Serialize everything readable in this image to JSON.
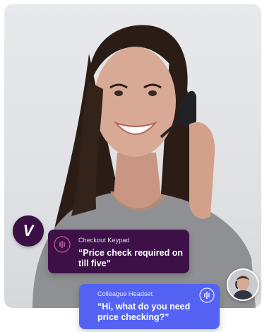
{
  "brand": {
    "logo_letter": "V"
  },
  "messages": [
    {
      "source": "Checkout Keypad",
      "text": "“Price check required on till five”",
      "icon": "sound-wave-icon"
    },
    {
      "source": "Colleague Headset",
      "text": "“Hi, what do you need price checking?”",
      "icon": "sound-wave-icon"
    }
  ],
  "colors": {
    "keypad_bubble": "#3d1148",
    "headset_bubble": "#5463f3",
    "brand_badge": "#3a1144"
  }
}
